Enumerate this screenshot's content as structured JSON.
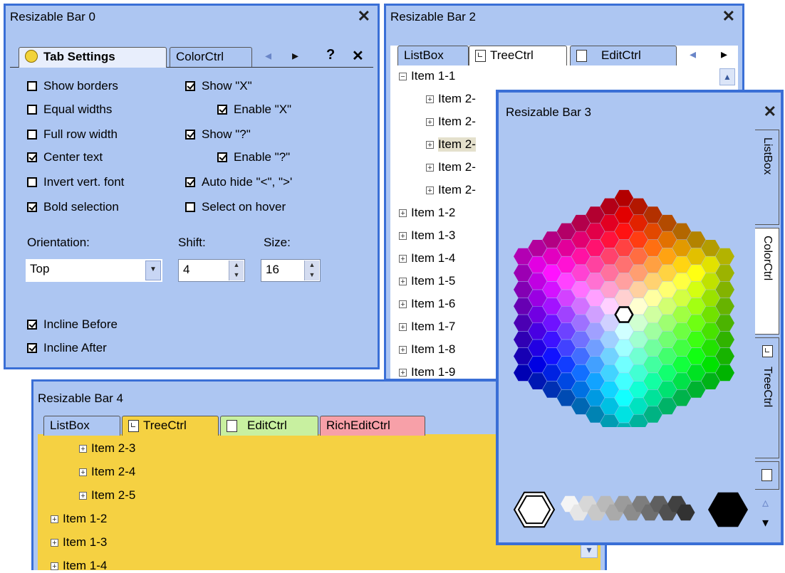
{
  "bar0": {
    "title": "Resizable Bar 0",
    "close": "✕",
    "tabs": [
      "Tab Settings",
      "ColorCtrl"
    ],
    "nav": {
      "left": "◂",
      "right": "▸",
      "help": "?",
      "close": "✕"
    },
    "checks_left": [
      {
        "label": "Show borders",
        "checked": false
      },
      {
        "label": "Equal widths",
        "checked": false
      },
      {
        "label": "Full row width",
        "checked": false
      },
      {
        "label": "Center text",
        "checked": true
      },
      {
        "label": "Invert vert. font",
        "checked": false
      },
      {
        "label": "Bold selection",
        "checked": true
      }
    ],
    "checks_right": [
      {
        "label": "Show \"X\"",
        "checked": true
      },
      {
        "label": "Enable \"X\"",
        "checked": true
      },
      {
        "label": "Show \"?\"",
        "checked": true
      },
      {
        "label": "Enable \"?\"",
        "checked": true
      },
      {
        "label": "Auto hide \"<\", \">'",
        "checked": true
      },
      {
        "label": "Select on hover",
        "checked": false
      }
    ],
    "orientation_label": "Orientation:",
    "orientation_value": "Top",
    "shift_label": "Shift:",
    "shift_value": "4",
    "size_label": "Size:",
    "size_value": "16",
    "incline_before": "Incline Before",
    "incline_after": "Incline After"
  },
  "bar2": {
    "title": "Resizable Bar 2",
    "close": "✕",
    "tabs": [
      "ListBox",
      "TreeCtrl",
      "EditCtrl"
    ],
    "nav": {
      "left": "◂",
      "right": "▸"
    },
    "tree": [
      "Item 1-1",
      "Item 2-",
      "Item 2-",
      "Item 2-",
      "Item 2-",
      "Item 2-",
      "Item 1-2",
      "Item 1-3",
      "Item 1-4",
      "Item 1-5",
      "Item 1-6",
      "Item 1-7",
      "Item 1-8",
      "Item 1-9"
    ],
    "scroll_up": "▲"
  },
  "bar3": {
    "title": "Resizable Bar 3",
    "close": "✕",
    "side_tabs": [
      "ListBox",
      "ColorCtrl",
      "TreeCtrl"
    ],
    "scroll_up": "▵",
    "scroll_down": "▾",
    "colors": {
      "selected": "#ffffff",
      "black": "#000000"
    }
  },
  "bar4": {
    "title": "Resizable Bar 4",
    "tabs": [
      "ListBox",
      "TreeCtrl",
      "EditCtrl",
      "RichEditCtrl"
    ],
    "tab_colors": {
      "treectrl": "#f5d142",
      "editctrl": "#c8f0a0",
      "richeditctrl": "#f7a0a8"
    },
    "tree": [
      "Item 2-3",
      "Item 2-4",
      "Item 2-5",
      "Item 1-2",
      "Item 1-3",
      "Item 1-4"
    ],
    "scroll_down": "▾"
  }
}
